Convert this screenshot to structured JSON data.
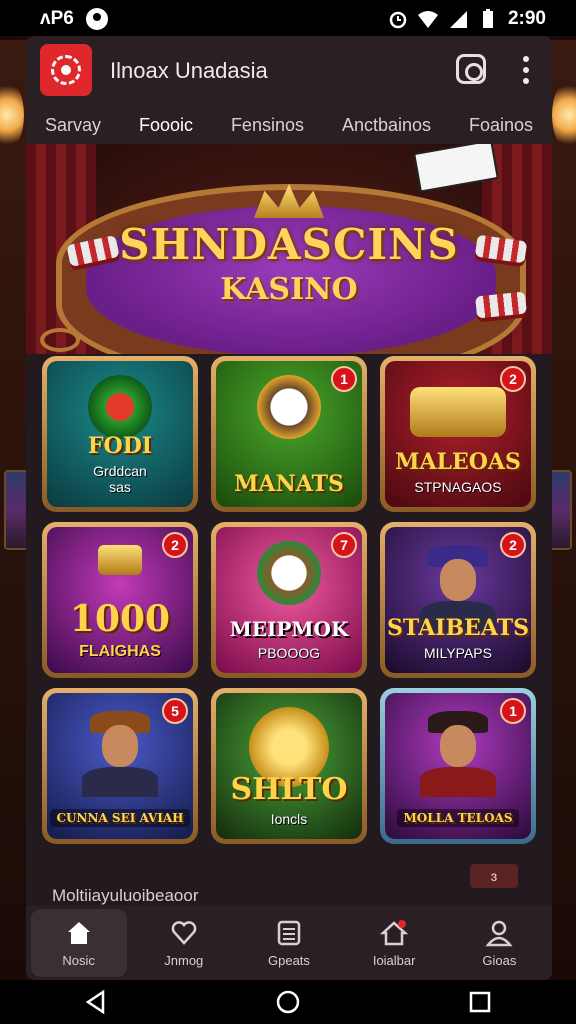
{
  "status_bar": {
    "carrier": "ᴧP6",
    "time": "2:90"
  },
  "header": {
    "title": "Ilnoax Unadasia"
  },
  "tabs": [
    {
      "label": "Sarvay",
      "active": false
    },
    {
      "label": "Foooic",
      "active": true
    },
    {
      "label": "Fensinos",
      "active": false
    },
    {
      "label": "Anctbainos",
      "active": false
    },
    {
      "label": "Foainos",
      "active": false
    }
  ],
  "banner": {
    "title": "SHNDASCINS",
    "subtitle": "KASINO"
  },
  "games": [
    {
      "title": "FODI",
      "subtitle": "Grddcan\nsas",
      "badge": "",
      "bg": "#0e5a5c"
    },
    {
      "title": "MANATS",
      "subtitle": "",
      "badge": "1",
      "bg": "#2f7a1a"
    },
    {
      "title": "MALEOAS",
      "subtitle": "STPNAGAOS",
      "badge": "2",
      "bg": "#7a1016"
    },
    {
      "title": "1000",
      "subtitle": "FLAIGHAS",
      "badge": "2",
      "bg": "#6a1e7a"
    },
    {
      "title": "MEIPMOK",
      "subtitle": "PBOOOG",
      "badge": "7",
      "bg": "#b8246a"
    },
    {
      "title": "STAIBEATS",
      "subtitle": "MILYPAPS",
      "badge": "2",
      "bg": "#3e1a5c"
    },
    {
      "title": "CUNNA SEI AVIAH",
      "subtitle": "",
      "badge": "5",
      "bg": "#2a3a8a"
    },
    {
      "title": "SHLTO",
      "subtitle": "Ioncls",
      "badge": "",
      "bg": "#2d5a1e"
    },
    {
      "title": "MOLLA TELOAS",
      "subtitle": "",
      "badge": "1",
      "bg": "#5a1e6a"
    }
  ],
  "section": {
    "label": "Moltiiayuluoibeaoor",
    "button": "ɜ"
  },
  "bottom_nav": [
    {
      "label": "Nosic",
      "icon": "home-icon",
      "active": true
    },
    {
      "label": "Jnmog",
      "icon": "heart-icon",
      "active": false
    },
    {
      "label": "Gpeats",
      "icon": "list-icon",
      "active": false
    },
    {
      "label": "Ioialbar",
      "icon": "house-alert-icon",
      "active": false
    },
    {
      "label": "Gioas",
      "icon": "user-icon",
      "active": false
    }
  ],
  "colors": {
    "accent": "#e0282c",
    "gold": "#ffd45a",
    "app_bg": "#231a1f"
  }
}
